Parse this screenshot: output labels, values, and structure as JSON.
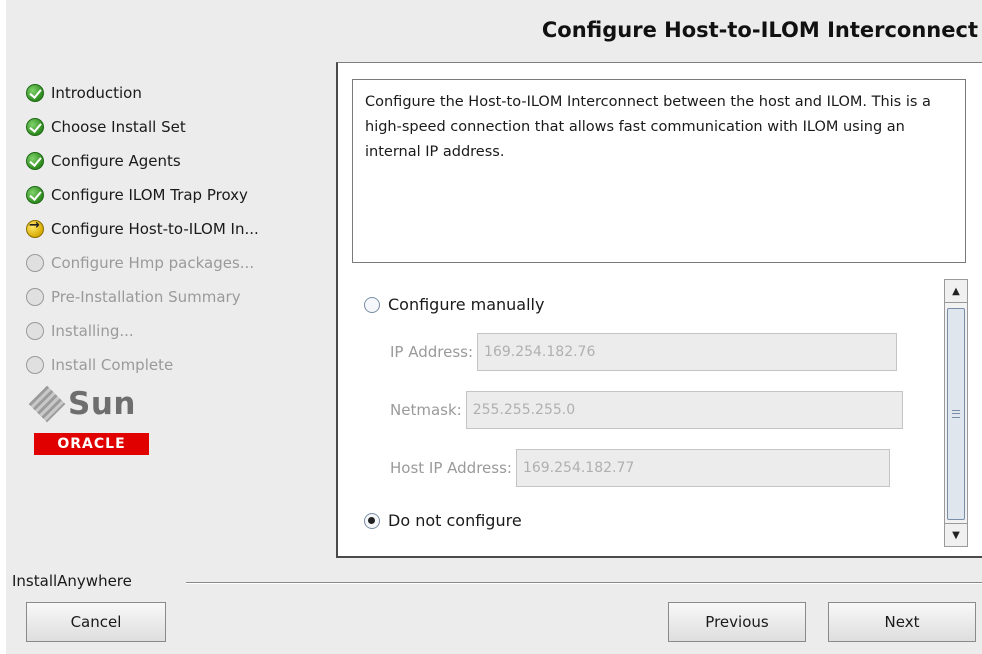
{
  "header": {
    "title": "Configure Host-to-ILOM Interconnect"
  },
  "steps": [
    {
      "label": "Introduction",
      "state": "done"
    },
    {
      "label": "Choose Install Set",
      "state": "done"
    },
    {
      "label": "Configure Agents",
      "state": "done"
    },
    {
      "label": "Configure ILOM Trap Proxy",
      "state": "done"
    },
    {
      "label": "Configure Host-to-ILOM In...",
      "state": "current"
    },
    {
      "label": "Configure Hmp packages...",
      "state": "pending"
    },
    {
      "label": "Pre-Installation Summary",
      "state": "pending"
    },
    {
      "label": "Installing...",
      "state": "pending"
    },
    {
      "label": "Install Complete",
      "state": "pending"
    }
  ],
  "logos": {
    "sun": "Sun",
    "oracle": "ORACLE"
  },
  "description": "Configure the Host-to-ILOM Interconnect between the host and ILOM.  This is a high-speed connection that allows fast communication with ILOM using an internal IP address.",
  "options": {
    "manual_label": "Configure manually",
    "manual_selected": false,
    "no_config_label": "Do not configure",
    "no_config_selected": true
  },
  "fields": {
    "ip_label": "IP Address:",
    "ip_value": "169.254.182.76",
    "netmask_label": "Netmask:",
    "netmask_value": "255.255.255.0",
    "host_ip_label": "Host IP Address:",
    "host_ip_value": "169.254.182.77"
  },
  "footer": {
    "brand": "InstallAnywhere",
    "cancel": "Cancel",
    "previous": "Previous",
    "next": "Next"
  }
}
